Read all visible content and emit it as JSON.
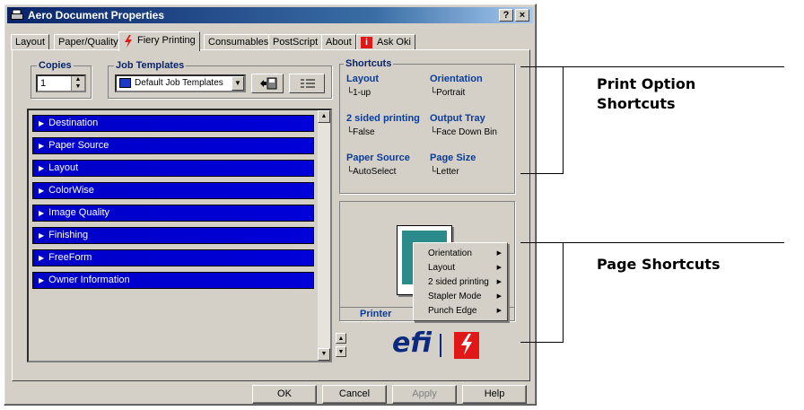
{
  "window": {
    "title": "Aero Document Properties",
    "help_btn": "?",
    "close_btn": "×"
  },
  "tabs": [
    "Layout",
    "Paper/Quality",
    "Fiery Printing",
    "Consumables",
    "PostScript",
    "About",
    "Ask Oki"
  ],
  "active_tab": "Fiery Printing",
  "copies": {
    "label": "Copies",
    "value": "1"
  },
  "job_templates": {
    "label": "Job Templates",
    "selected": "Default Job Templates"
  },
  "sections": [
    "Destination",
    "Paper Source",
    "Layout",
    "ColorWise",
    "Image Quality",
    "Finishing",
    "FreeForm",
    "Owner Information"
  ],
  "shortcuts": {
    "label": "Shortcuts",
    "items": [
      {
        "label": "Layout",
        "value": "1-up"
      },
      {
        "label": "Orientation",
        "value": "Portrait"
      },
      {
        "label": "2 sided printing",
        "value": "False"
      },
      {
        "label": "Output Tray",
        "value": "Face Down Bin"
      },
      {
        "label": "Paper Source",
        "value": "AutoSelect"
      },
      {
        "label": "Page Size",
        "value": "Letter"
      }
    ]
  },
  "preview": {
    "tab_label": "Printer"
  },
  "context_menu": [
    "Orientation",
    "Layout",
    "2 sided printing",
    "Stapler Mode",
    "Punch Edge"
  ],
  "logo": {
    "text": "efi"
  },
  "buttons": {
    "ok": "OK",
    "cancel": "Cancel",
    "apply": "Apply",
    "help": "Help"
  },
  "callouts": {
    "print_option": [
      "Print Option",
      "Shortcuts"
    ],
    "page": "Page Shortcuts"
  },
  "colors": {
    "title_bar": "#0a246a",
    "section_bar": "#0000d0",
    "shortcut_label": "#0a3c9a",
    "fiery_red": "#e01818"
  }
}
